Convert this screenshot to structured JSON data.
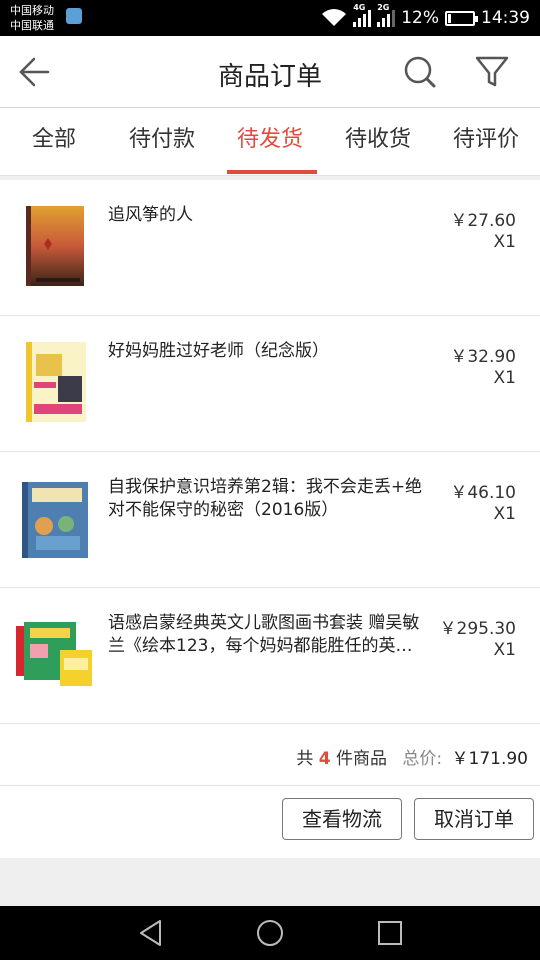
{
  "status_bar": {
    "carrier_1": "中国移动",
    "carrier_2": "中国联通",
    "net_1": "4G",
    "net_2": "2G",
    "battery": "12%",
    "time": "14:39"
  },
  "header": {
    "title": "商品订单",
    "back_icon": "arrow-left-icon",
    "search_icon": "search-icon",
    "filter_icon": "filter-icon"
  },
  "tabs": [
    {
      "label": "全部",
      "active": false
    },
    {
      "label": "待付款",
      "active": false
    },
    {
      "label": "待发货",
      "active": true
    },
    {
      "label": "待收货",
      "active": false
    },
    {
      "label": "待评价",
      "active": false
    }
  ],
  "items": [
    {
      "title": "追风筝的人",
      "price": "￥27.60",
      "qty": "X1"
    },
    {
      "title": "好妈妈胜过好老师（纪念版）",
      "price": "￥32.90",
      "qty": "X1"
    },
    {
      "title": "自我保护意识培养第2辑：我不会走丢+绝对不能保守的秘密（2016版）",
      "price": "￥46.10",
      "qty": "X1"
    },
    {
      "title": "语感启蒙经典英文儿歌图画书套装 赠吴敏兰《绘本123，每个妈妈都能胜任的英…",
      "price": "￥295.30",
      "qty": "X1"
    }
  ],
  "summary": {
    "prefix": "共",
    "count": "4",
    "suffix": "件商品",
    "total_label": "总价:",
    "total": "￥171.90"
  },
  "actions": {
    "logistics": "查看物流",
    "cancel": "取消订单"
  },
  "colors": {
    "accent": "#e14b3c",
    "status_bar": "#000000",
    "background": "#efefef"
  }
}
